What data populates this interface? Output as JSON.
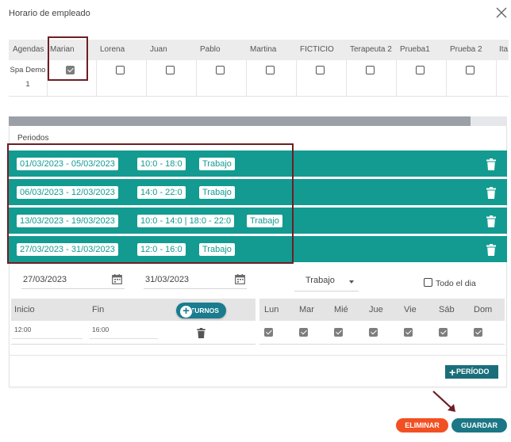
{
  "dialog": {
    "title": "Horario de empleado"
  },
  "agenda_table": {
    "header_label": "Agendas",
    "agenda_name": "Spa Demo 1",
    "employees": [
      {
        "name": "Marian",
        "checked": true
      },
      {
        "name": "Lorena",
        "checked": false
      },
      {
        "name": "Juan",
        "checked": false
      },
      {
        "name": "Pablo",
        "checked": false
      },
      {
        "name": "Martina",
        "checked": false
      },
      {
        "name": "FICTICIO",
        "checked": false
      },
      {
        "name": "Terapeuta 2",
        "checked": false
      },
      {
        "name": "Prueba1",
        "checked": false
      },
      {
        "name": "Prueba 2",
        "checked": false
      },
      {
        "name": "Ita",
        "checked": false
      }
    ]
  },
  "scrollbar": {
    "position": 0.93
  },
  "periods": {
    "label": "Periodos",
    "items": [
      {
        "dates": "01/03/2023 - 05/03/2023",
        "hours": "10:0 - 18:0",
        "type": "Trabajo"
      },
      {
        "dates": "06/03/2023 - 12/03/2023",
        "hours": "14:0 - 22:0",
        "type": "Trabajo"
      },
      {
        "dates": "13/03/2023 - 19/03/2023",
        "hours": "10:0 - 14:0 | 18:0 - 22:0",
        "type": "Trabajo"
      },
      {
        "dates": "27/03/2023 - 31/03/2023",
        "hours": "12:0 - 16:0",
        "type": "Trabajo"
      }
    ]
  },
  "form": {
    "start_date": "27/03/2023",
    "end_date": "31/03/2023",
    "type_value": "Trabajo",
    "all_day_label": "Todo el dia",
    "all_day_checked": false
  },
  "shifts": {
    "col_start": "Inicio",
    "col_end": "Fin",
    "add_button": "TURNOS",
    "rows": [
      {
        "start": "12:00",
        "end": "16:00"
      }
    ]
  },
  "weekdays": {
    "labels": [
      "Lun",
      "Mar",
      "Mié",
      "Jue",
      "Vie",
      "Sáb",
      "Dom"
    ],
    "checked": [
      true,
      true,
      true,
      true,
      true,
      true,
      true
    ]
  },
  "buttons": {
    "add_period": "PERÍODO",
    "delete": "ELIMINAR",
    "save": "GUARDAR"
  },
  "colors": {
    "teal": "#139b91",
    "dark_teal": "#1a7c8e",
    "highlight": "#6e1e24",
    "danger": "#f25022"
  }
}
